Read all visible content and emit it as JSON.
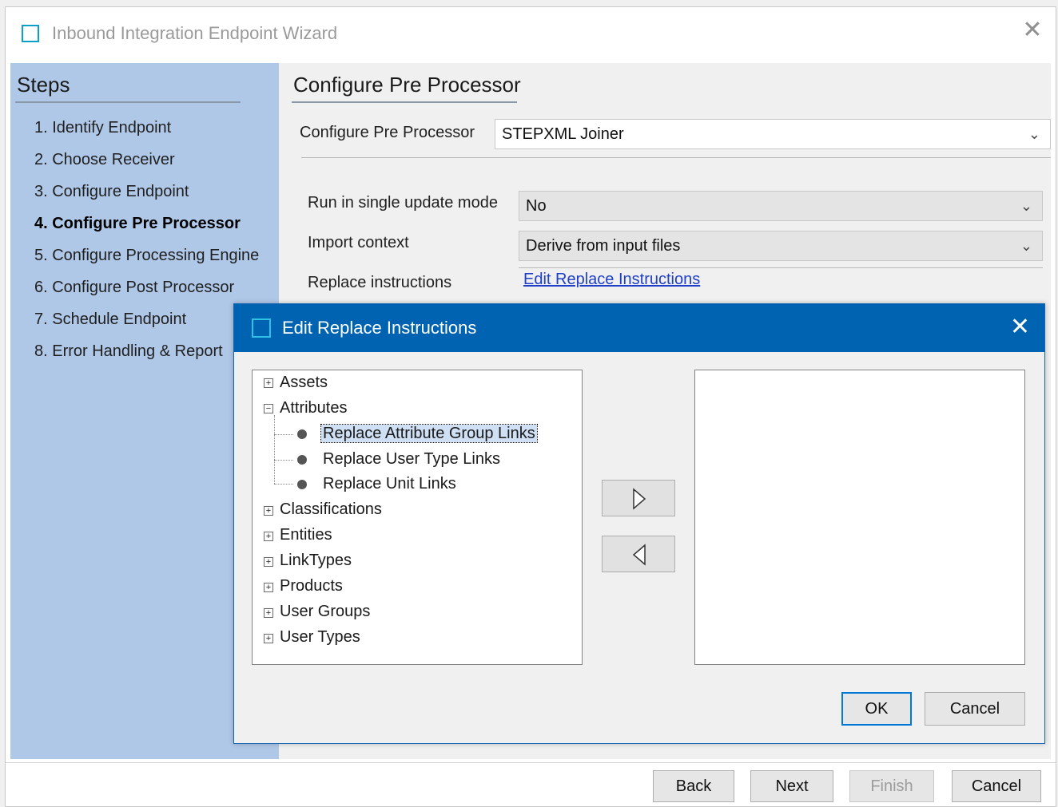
{
  "wizard": {
    "title": "Inbound Integration Endpoint Wizard",
    "close_glyph": "✕",
    "steps_title": "Steps",
    "steps": [
      {
        "label": "1. Identify Endpoint",
        "active": false
      },
      {
        "label": "2. Choose Receiver",
        "active": false
      },
      {
        "label": "3. Configure Endpoint",
        "active": false
      },
      {
        "label": "4. Configure Pre Processor",
        "active": true
      },
      {
        "label": "5. Configure Processing Engine",
        "active": false
      },
      {
        "label": "6. Configure Post Processor",
        "active": false
      },
      {
        "label": "7. Schedule Endpoint",
        "active": false
      },
      {
        "label": "8. Error Handling & Report",
        "active": false
      }
    ],
    "content_title": "Configure Pre Processor",
    "pre_processor": {
      "label": "Configure Pre Processor",
      "value": "STEPXML Joiner"
    },
    "single_update": {
      "label": "Run in single update mode",
      "value": "No"
    },
    "import_context": {
      "label": "Import context",
      "value": "Derive from input files"
    },
    "replace_instructions": {
      "label": "Replace instructions",
      "link": "Edit Replace Instructions"
    },
    "buttons": {
      "back": "Back",
      "next": "Next",
      "finish": "Finish",
      "cancel": "Cancel"
    }
  },
  "dialog": {
    "title": "Edit Replace Instructions",
    "close_glyph": "✕",
    "tree": {
      "assets": "Assets",
      "attributes": "Attributes",
      "attribute_children": [
        "Replace Attribute Group Links",
        "Replace User Type Links",
        "Replace Unit Links"
      ],
      "classifications": "Classifications",
      "entities": "Entities",
      "linktypes": "LinkTypes",
      "products": "Products",
      "user_groups": "User Groups",
      "user_types": "User Types"
    },
    "selected_node": "Replace Attribute Group Links",
    "buttons": {
      "ok": "OK",
      "cancel": "Cancel"
    }
  },
  "icons": {
    "app": "wizard-window-icon",
    "add": "arrow-right-icon",
    "remove": "arrow-left-icon"
  },
  "colors": {
    "steps_panel": "#b0c8e8",
    "dialog_titlebar": "#0063b1",
    "link": "#1f3fc8"
  }
}
